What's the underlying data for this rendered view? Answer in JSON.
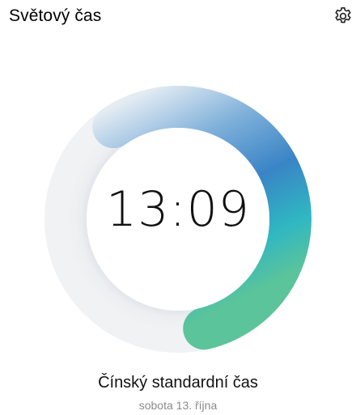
{
  "header": {
    "title": "Světový čas",
    "settings_icon": "gear-icon"
  },
  "clock": {
    "time": "13:09",
    "timezone": "Čínský standardní čas",
    "date": "sobota 13. října",
    "dial_progress": 0.56
  },
  "colors": {
    "track": "#eceef1",
    "arc_start": "#5cc49a",
    "arc_mid": "#2fb7c2",
    "arc_top": "#3a7fc4",
    "arc_fade": "#c9dcea"
  }
}
